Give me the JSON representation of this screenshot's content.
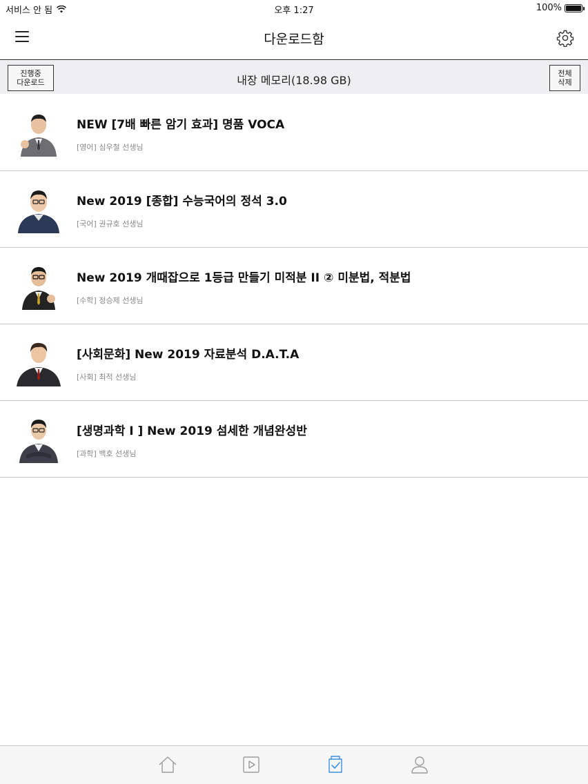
{
  "status_bar": {
    "carrier": "서비스 안 됨",
    "time": "오후 1:27",
    "battery": "100%"
  },
  "nav": {
    "title": "다운로드함",
    "menu_icon": "hamburger-icon",
    "settings_icon": "gear-icon"
  },
  "storage": {
    "progress_button": {
      "line1": "진행중",
      "line2": "다운로드"
    },
    "text": "내장 메모리(18.98 GB)",
    "delete_all_button": {
      "line1": "전체",
      "line2": "삭제"
    }
  },
  "courses": [
    {
      "title": "NEW [7배 빠른 암기 효과] 명품 VOCA",
      "subtitle": "[영어] 심우철 선생님"
    },
    {
      "title": "New 2019 [종합] 수능국어의 정석 3.0",
      "subtitle": "[국어] 권규호 선생님"
    },
    {
      "title": "New 2019 개때잡으로 1등급 만들기 미적분 II ② 미분법, 적분법",
      "subtitle": "[수학] 정승제 선생님"
    },
    {
      "title": "[사회문화] New 2019 자료분석 D.A.T.A",
      "subtitle": "[사회] 최적 선생님"
    },
    {
      "title": "[생명과학 I ] New 2019 섬세한 개념완성반",
      "subtitle": "[과학] 백호 선생님"
    }
  ],
  "tabbar": {
    "tabs": [
      "home-icon",
      "play-icon",
      "download-box-icon",
      "person-icon"
    ],
    "active_color": "#3a8ee6",
    "inactive_color": "#9a9a9a"
  }
}
